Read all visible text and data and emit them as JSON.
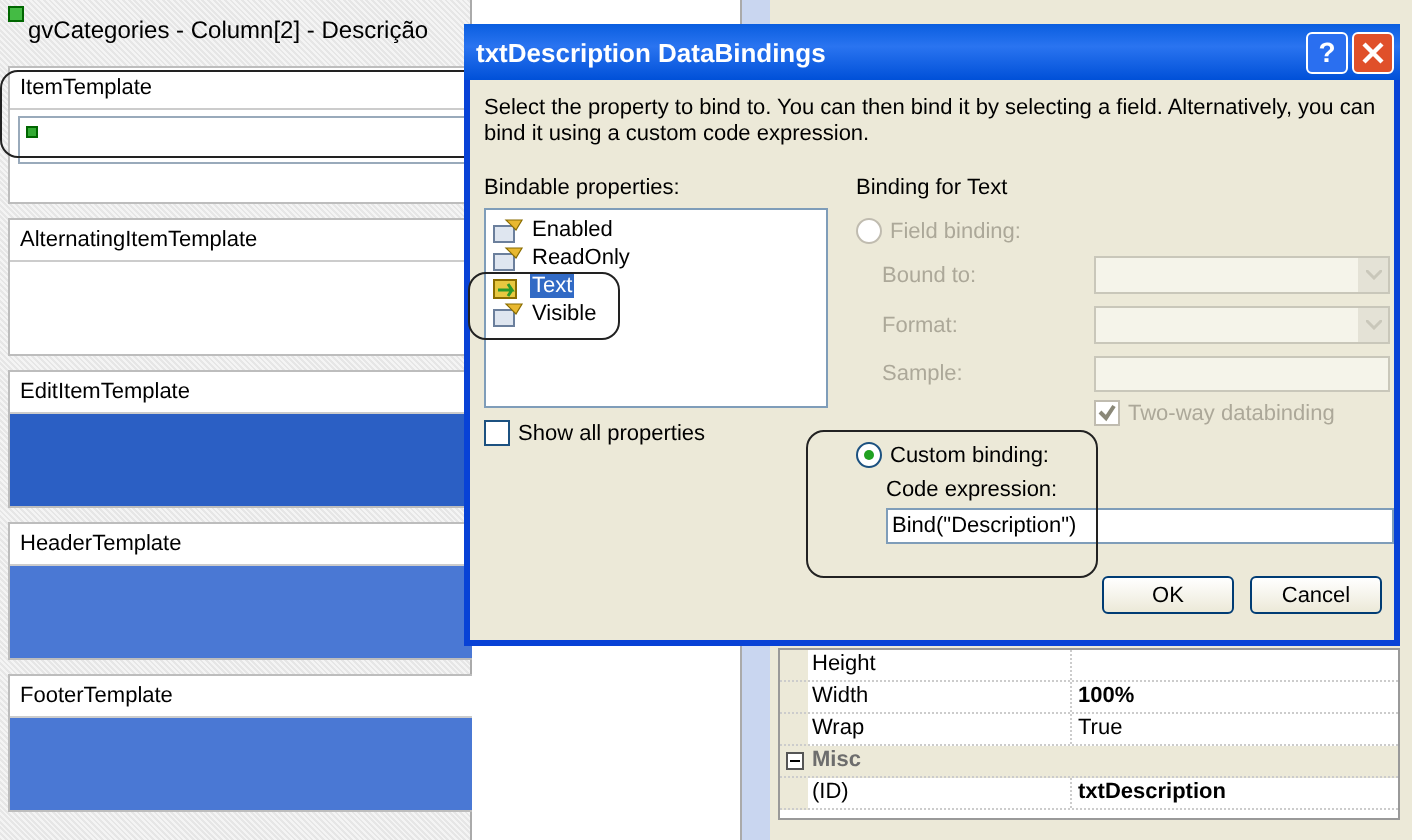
{
  "designer": {
    "title": "gvCategories - Column[2] - Descrição",
    "templates": [
      {
        "name": "ItemTemplate",
        "kind": "textbox"
      },
      {
        "name": "AlternatingItemTemplate",
        "kind": "empty"
      },
      {
        "name": "EditItemTemplate",
        "kind": "fill",
        "color": "#2b5fc4"
      },
      {
        "name": "HeaderTemplate",
        "kind": "fill",
        "color": "#4a78d4"
      },
      {
        "name": "FooterTemplate",
        "kind": "fill",
        "color": "#4a78d4"
      }
    ]
  },
  "properties": {
    "rows": [
      {
        "kind": "property",
        "name": "Height"
      },
      {
        "kind": "property",
        "name": "Width",
        "value": "100%",
        "modified": true
      },
      {
        "kind": "property",
        "name": "Wrap",
        "value": "True",
        "modified": false
      },
      {
        "kind": "category",
        "name": "Misc",
        "expanded": true
      },
      {
        "kind": "property",
        "name": "(ID)",
        "value": "txtDescription",
        "modified": true
      }
    ]
  },
  "dialog": {
    "title": "txtDescription DataBindings",
    "help": "?",
    "description": "Select the property to bind to. You can then bind it by selecting a field. Alternatively, you can bind it using a custom code expression.",
    "bindable_label": "Bindable properties:",
    "bindable": [
      {
        "label": "Enabled",
        "selected": false,
        "bound": false
      },
      {
        "label": "ReadOnly",
        "selected": false,
        "bound": false
      },
      {
        "label": "Text",
        "selected": true,
        "bound": true
      },
      {
        "label": "Visible",
        "selected": false,
        "bound": false
      }
    ],
    "show_all": {
      "label": "Show all properties",
      "checked": false
    },
    "binding_title": "Binding for Text",
    "field_binding": {
      "label": "Field binding:",
      "selected": false,
      "disabled": true
    },
    "bound_to": {
      "label": "Bound to:",
      "disabled": true
    },
    "format": {
      "label": "Format:",
      "disabled": true
    },
    "sample": {
      "label": "Sample:",
      "disabled": true
    },
    "two_way": {
      "label": "Two-way databinding",
      "checked": true,
      "disabled": true
    },
    "custom_binding": {
      "label": "Custom binding:",
      "selected": true
    },
    "code_expression": {
      "label": "Code expression:",
      "value": "Bind(\"Description\")"
    },
    "buttons": [
      "OK",
      "Cancel"
    ]
  }
}
